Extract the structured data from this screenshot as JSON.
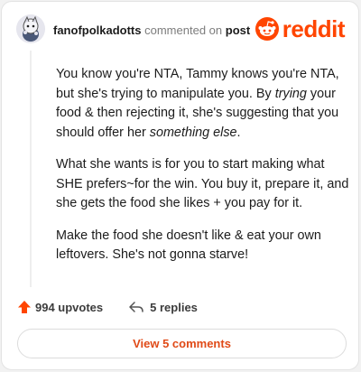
{
  "header": {
    "username": "fanofpolkadotts",
    "action_text": "commented on",
    "post_link": "post"
  },
  "logo": {
    "wordmark": "reddit",
    "icon": "reddit-snoo-icon",
    "color": "#ff4500"
  },
  "comment": {
    "p1_a": "You know you're NTA, Tammy knows you're NTA, but she's trying to manipulate you. By ",
    "p1_em1": "trying",
    "p1_b": " your food & then rejecting it, she's suggesting that you should offer her ",
    "p1_em2": "something else",
    "p1_c": ".",
    "p2": "What she wants is for you to start making what SHE prefers~for the win. You buy it, prepare it, and she gets the food she likes + you pay for it.",
    "p3": "Make the food she doesn't like & eat your own leftovers. She's not gonna starve!"
  },
  "actions": {
    "upvotes": "994 upvotes",
    "replies": "5 replies",
    "upvote_icon": "arrow-up-icon",
    "reply_icon": "reply-arrow-icon"
  },
  "view_button": {
    "label": "View 5 comments"
  },
  "colors": {
    "accent": "#ff4500",
    "link": "#e04a17"
  }
}
